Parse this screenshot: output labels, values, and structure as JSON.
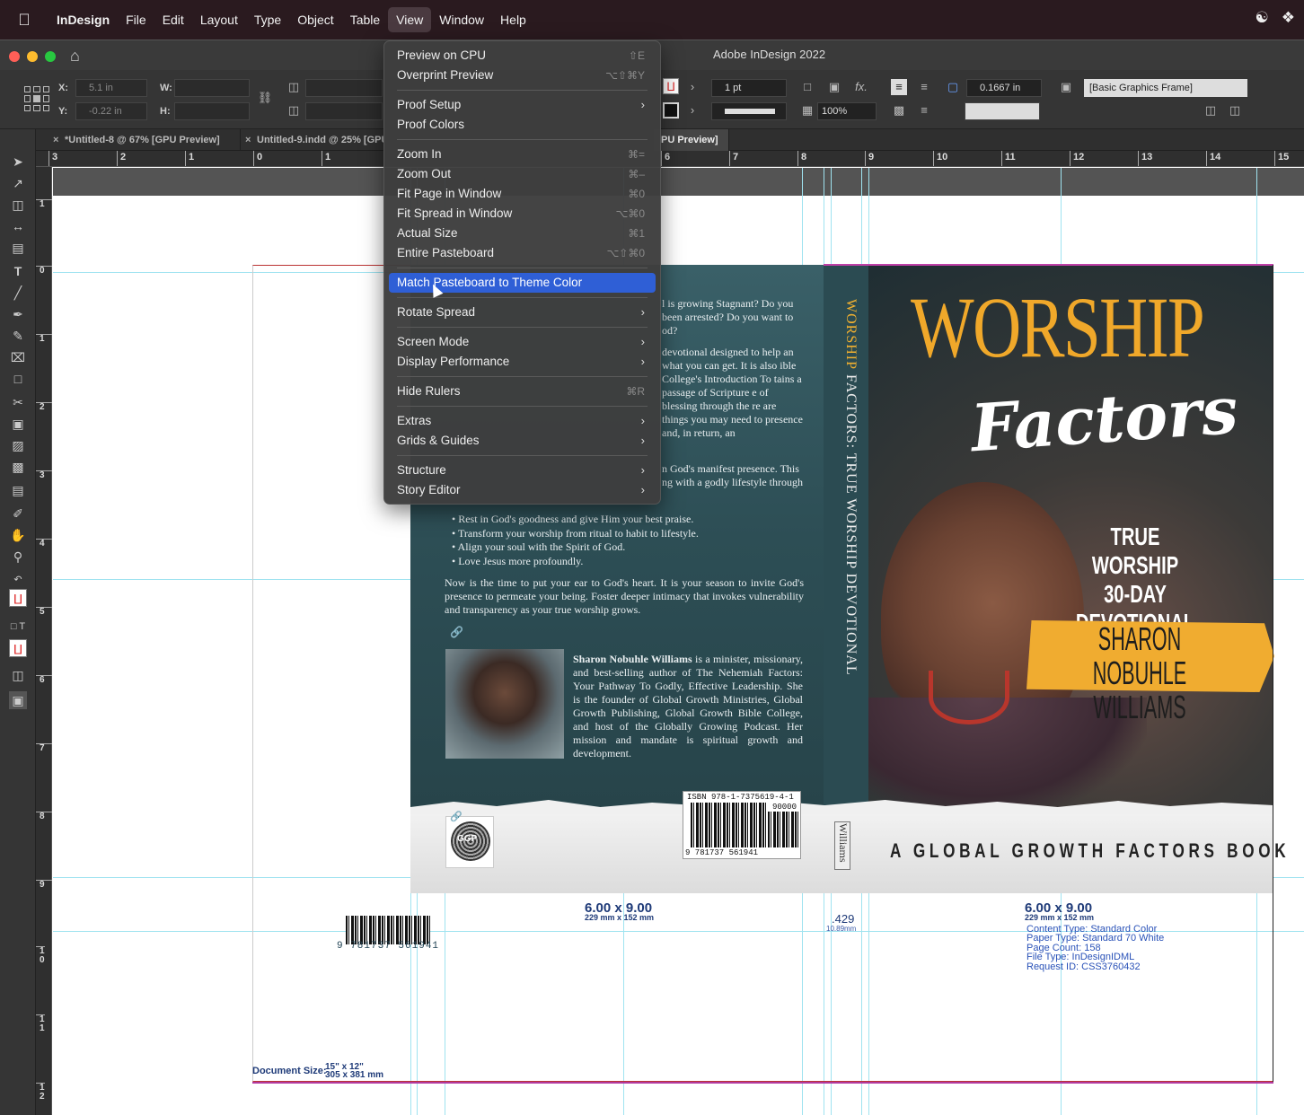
{
  "menubar": {
    "app_name": "InDesign",
    "items": [
      "File",
      "Edit",
      "Layout",
      "Type",
      "Object",
      "Table",
      "View",
      "Window",
      "Help"
    ],
    "active": "View"
  },
  "window": {
    "title": "Adobe InDesign 2022"
  },
  "control_panel": {
    "x_label": "X:",
    "x_value": "5.1 in",
    "y_label": "Y:",
    "y_value": "-0.22 in",
    "w_label": "W:",
    "h_label": "H:",
    "stroke_weight": "1 pt",
    "opacity": "100%",
    "offset_value": "0.1667 in",
    "object_style": "[Basic Graphics Frame]",
    "fx_label": "fx."
  },
  "tabs": [
    {
      "label": "*Untitled-8 @ 67% [GPU Preview]"
    },
    {
      "label": "Untitled-9.indd @ 25% [GPU Preview]"
    },
    {
      "label": "PU Preview]"
    }
  ],
  "ruler": {
    "h_ticks": [
      "3",
      "2",
      "1",
      "0",
      "1",
      "6",
      "7",
      "8",
      "9",
      "10",
      "11",
      "12",
      "13",
      "14",
      "15"
    ],
    "v_ticks": [
      "1",
      "0",
      "1",
      "2",
      "3",
      "4",
      "5",
      "6",
      "7",
      "8",
      "9",
      "1 0",
      "1 1",
      "1 2"
    ]
  },
  "view_menu": {
    "items": [
      {
        "label": "Preview on CPU",
        "shortcut": "⇧E"
      },
      {
        "label": "Overprint Preview",
        "shortcut": "⌥⇧⌘Y"
      },
      {
        "sep": true
      },
      {
        "label": "Proof Setup",
        "submenu": true
      },
      {
        "label": "Proof Colors"
      },
      {
        "sep": true
      },
      {
        "label": "Zoom In",
        "shortcut": "⌘="
      },
      {
        "label": "Zoom Out",
        "shortcut": "⌘–"
      },
      {
        "label": "Fit Page in Window",
        "shortcut": "⌘0"
      },
      {
        "label": "Fit Spread in Window",
        "shortcut": "⌥⌘0"
      },
      {
        "label": "Actual Size",
        "shortcut": "⌘1"
      },
      {
        "label": "Entire Pasteboard",
        "shortcut": "⌥⇧⌘0"
      },
      {
        "sep": true
      },
      {
        "label": "Match Pasteboard to Theme Color",
        "highlighted": true
      },
      {
        "sep": true
      },
      {
        "label": "Rotate Spread",
        "submenu": true
      },
      {
        "sep": true
      },
      {
        "label": "Screen Mode",
        "submenu": true
      },
      {
        "label": "Display Performance",
        "submenu": true
      },
      {
        "sep": true
      },
      {
        "label": "Hide Rulers",
        "shortcut": "⌘R"
      },
      {
        "sep": true
      },
      {
        "label": "Extras",
        "submenu": true
      },
      {
        "label": "Grids & Guides",
        "submenu": true
      },
      {
        "sep": true
      },
      {
        "label": "Structure",
        "submenu": true
      },
      {
        "label": "Story Editor",
        "submenu": true
      }
    ]
  },
  "cover": {
    "back_para1": "l is growing Stagnant? Do you been arrested? Do you want to od?",
    "back_para2": "devotional designed to help an what you can get. It is also ible College's Introduction To tains a passage of Scripture e of blessing through the re are things you may need to presence and, in return, an",
    "back_para3": "n God's manifest presence. This ng with a godly lifestyle through",
    "bullets": [
      "Rest in God's goodness and give Him your best praise.",
      "Transform your worship from ritual to habit to lifestyle.",
      "Align your soul with the Spirit of God.",
      "Love Jesus more profoundly."
    ],
    "back_para4": "Now is the time to put your ear to God's heart. It is your season to invite God's presence to permeate your being. Foster deeper intimacy that invokes vulnerability and transparency as your true worship grows.",
    "bio_name": "Sharon Nobuhle Williams",
    "bio_text": " is a minister, missionary, and best-selling author of The Nehemiah Factors: Your Pathway To Godly, Effective Leadership. She is the founder of Global Growth Ministries, Global Growth Publishing, Global Growth Bible College, and host of the Globally Growing Podcast. Her mission and mandate is spiritual growth and development.",
    "spine_title_1": "WORSHIP",
    "spine_title_2": " FACTORS: TRUE WORSHIP DEVOTIONAL",
    "spine_author": "Williams",
    "title_1": "WORSHIP",
    "title_2": "Factors",
    "subtitle_1": "TRUE WORSHIP",
    "subtitle_2": "30-DAY DEVOTIONAL",
    "author_1": "SHARON NOBUHLE",
    "author_2": "WILLIAMS",
    "tagline": "A GLOBAL GROWTH FACTORS BOOK",
    "logo_text": "GGP",
    "isbn_label": "ISBN 978-1-7375619-4-1",
    "isbn_price": "90000",
    "isbn_number": "9 781737 561941"
  },
  "pasteboard": {
    "barcode_number": "9 781737 561941",
    "dim_left": "6.00 x 9.00",
    "dim_left_mm": "229 mm x 152 mm",
    "spine_width": ".429",
    "spine_width_mm": "10.89mm",
    "dim_right": "6.00 x 9.00",
    "dim_right_mm": "229 mm x 152 mm",
    "info_lines": [
      "Content Type: Standard Color",
      "Paper Type: Standard 70 White",
      "Page Count: 158",
      "File Type: InDesignIDML",
      "Request ID: CSS3760432"
    ],
    "doc_size_label": "Document Size:",
    "doc_size_in": "15\" x 12\"",
    "doc_size_mm": "305 x 381 mm"
  }
}
